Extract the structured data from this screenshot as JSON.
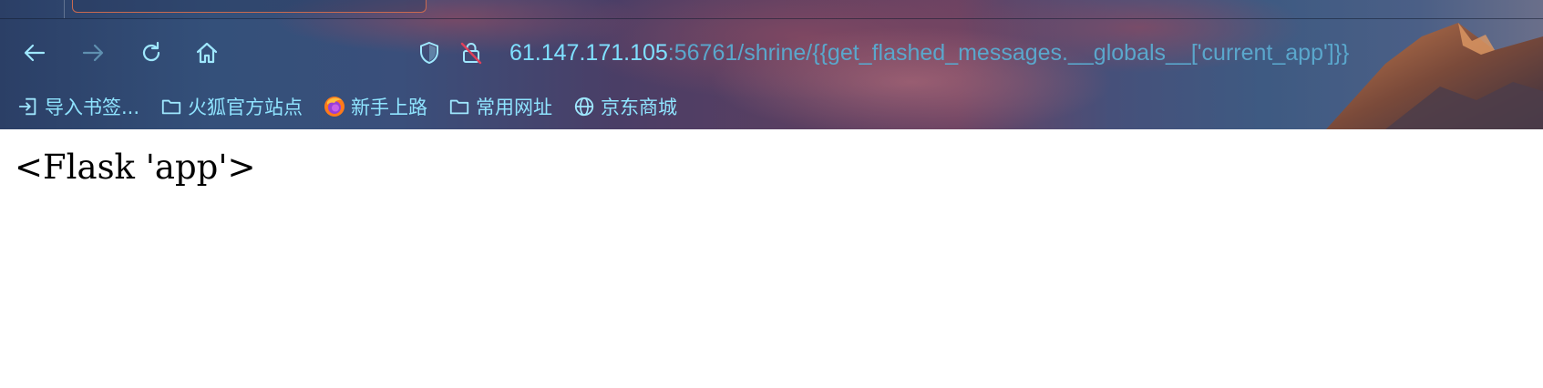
{
  "browser": {
    "toolbar": {
      "back_icon": "arrow-left-icon",
      "forward_icon": "arrow-right-icon",
      "reload_icon": "reload-icon",
      "home_icon": "home-icon"
    },
    "url_bar": {
      "shield_icon": "shield-icon",
      "insecure_lock_icon": "lock-crossed-icon",
      "host": "61.147.171.105",
      "rest": ":56761/shrine/{{get_flashed_messages.__globals__['current_app']}}"
    },
    "bookmarks": [
      {
        "label": "导入书签...",
        "icon": "import-icon"
      },
      {
        "label": "火狐官方站点",
        "icon": "folder-icon"
      },
      {
        "label": "新手上路",
        "icon": "firefox-logo-icon"
      },
      {
        "label": "常用网址",
        "icon": "folder-icon"
      },
      {
        "label": "京东商城",
        "icon": "globe-icon"
      }
    ]
  },
  "page": {
    "body_text": "<Flask 'app'>"
  },
  "colors": {
    "toolbar_icon": "#9fe8ff",
    "url_host": "#7fe0ff",
    "url_rest": "#5aa7cc",
    "bookmark_label": "#8fe4ff",
    "lock_slash": "#e0405a"
  }
}
